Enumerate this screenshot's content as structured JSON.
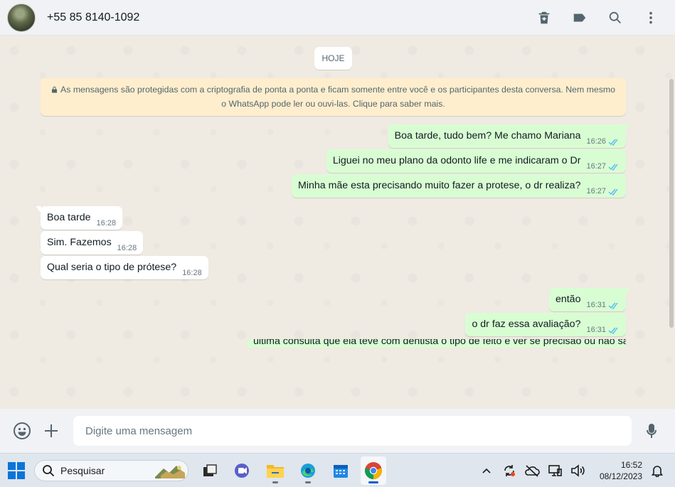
{
  "header": {
    "contact_name": "+55 85 8140-1092",
    "icons": [
      "delete-chat-icon",
      "label-icon",
      "search-icon",
      "menu-icon"
    ]
  },
  "chat": {
    "day_chip": "HOJE",
    "encryption_notice": "As mensagens são protegidas com a criptografia de ponta a ponta e ficam somente entre você e os participantes desta conversa. Nem mesmo o WhatsApp pode ler ou ouvi-las. Clique para saber mais.",
    "messages": [
      {
        "dir": "out",
        "text": "Boa tarde, tudo bem? Me chamo Mariana",
        "time": "16:26"
      },
      {
        "dir": "out",
        "text": "Liguei no meu plano da odonto life e me indicaram o Dr",
        "time": "16:27"
      },
      {
        "dir": "out",
        "text": "Minha mãe esta precisando muito fazer a protese, o dr realiza?",
        "time": "16:27"
      },
      {
        "dir": "in",
        "text": "Boa tarde",
        "time": "16:28"
      },
      {
        "dir": "in",
        "text": "Sim. Fazemos",
        "time": "16:28"
      },
      {
        "dir": "in",
        "text": "Qual seria o tipo de prótese?",
        "time": "16:28"
      },
      {
        "dir": "out",
        "text": "então",
        "time": "16:31"
      },
      {
        "dir": "out",
        "text": "o dr faz essa avaliação?",
        "time": "16:31"
      }
    ],
    "partial_text": "última consulta que ela teve com dentista o tipo de feito e ver se precisão ou não são"
  },
  "composer": {
    "placeholder": "Digite uma mensagem"
  },
  "taskbar": {
    "search_label": "Pesquisar",
    "time": "16:52",
    "date": "08/12/2023"
  },
  "colors": {
    "outgoing_bubble": "#d9fdd3",
    "incoming_bubble": "#ffffff",
    "read_ticks": "#53bdeb",
    "notice_bg": "#ffeecd"
  }
}
